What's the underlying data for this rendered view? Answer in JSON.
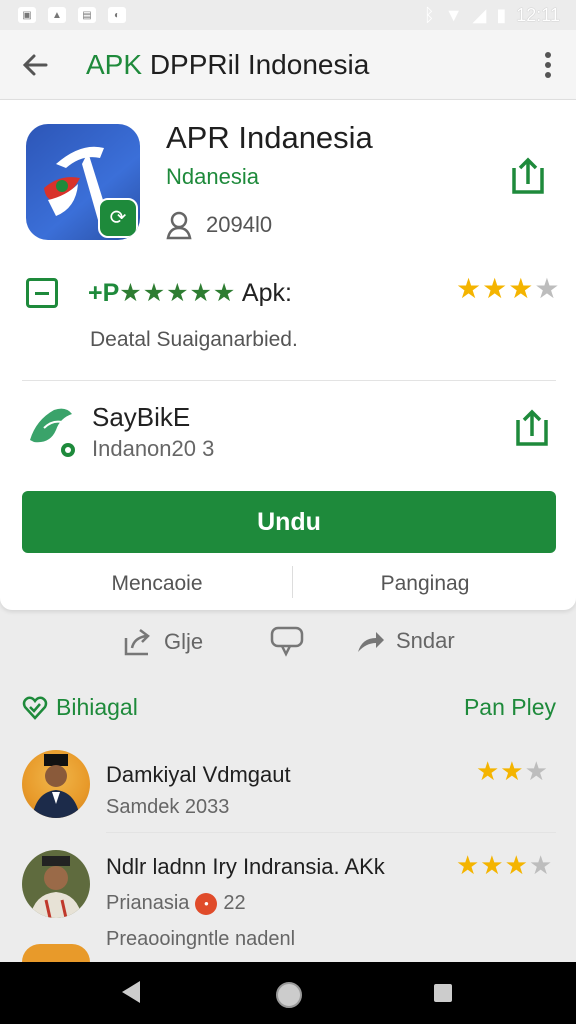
{
  "status_bar": {
    "time": "12:11"
  },
  "app_bar": {
    "title_part1": "APK ",
    "title_part2": "DPPRil Indonesia"
  },
  "app": {
    "name": "APR Indanesia",
    "developer": "Ndanesia",
    "downloads": "2094l0"
  },
  "info_row": {
    "title_prefix": "+P",
    "title_stars": "★★★★★",
    "title_suffix": "Apk:",
    "subtitle": "Deatal Suaiganarbied.",
    "rating_stars_on": "★★★",
    "rating_stars_off": "★"
  },
  "publisher_row": {
    "title": "SayBikE",
    "subtitle": "Indanon20 3"
  },
  "install_button": {
    "label": "Undu"
  },
  "tabs": {
    "left": "Mencaoie",
    "right": "Panginag"
  },
  "actions": {
    "share": "Glje",
    "comment_icon": "speech-bubble-icon",
    "send": "Sndar"
  },
  "reviews_section": {
    "left_label": "Bihiagal",
    "right_label": "Pan Pley"
  },
  "reviews": [
    {
      "name": "Damkiyal Vdmgaut",
      "subtitle": "Samdek 2033",
      "stars_on": "★★",
      "stars_off": "★"
    },
    {
      "name": "Ndlr ladnn Iry Indransia. AKk",
      "subtitle_prefix": "Prianasia",
      "subtitle_suffix": "22",
      "extra": "Preaooingntle nadenl",
      "stars_on": "★★★",
      "stars_off": "★"
    }
  ],
  "colors": {
    "accent": "#1e8a3b",
    "star": "#f4b400",
    "app_icon": "#2d56b7"
  }
}
